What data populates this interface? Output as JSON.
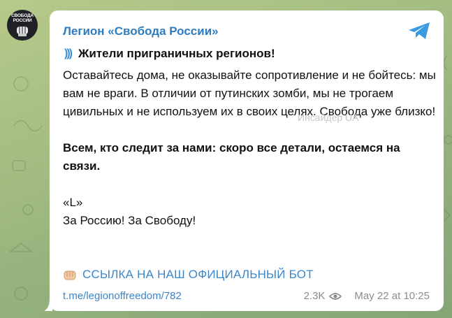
{
  "channel": {
    "name": "Легион «Свобода России»",
    "avatar_text": "СВОБОДА РОССИИ"
  },
  "message": {
    "heading_icon": "signal-waves-icon",
    "heading": "Жители приграничных регионов!",
    "paragraph1": "Оставайтесь дома, не оказывайте сопротивление и не бойтесь: мы вам не враги. В отличии от путинских зомби, мы не трогаем цивильных и не используем их в своих целях. Свобода уже близко!",
    "paragraph2": "Всем, кто следит за нами: скоро все детали, остаемся на связи.",
    "signature": "«L»",
    "slogan": "За Россию! За Свободу!",
    "bot_link_text": "ССЫЛКА НА НАШ ОФИЦИАЛЬНЫЙ БОТ"
  },
  "watermark": "Инсайдер UA",
  "footer": {
    "link": "t.me/legionoffreedom/782",
    "views": "2.3K",
    "time": "May 22 at 10:25"
  },
  "colors": {
    "link": "#3b86c9",
    "channel_name": "#2f7bbf",
    "telegram_icon": "#3a9be0"
  }
}
